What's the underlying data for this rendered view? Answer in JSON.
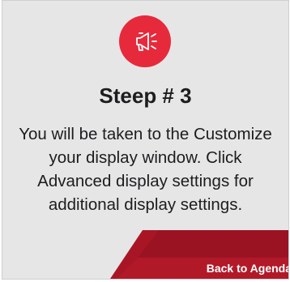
{
  "icon": {
    "name": "megaphone-icon",
    "bg_color": "#e72a3b"
  },
  "step_title": "Steep # 3",
  "instruction_lines": [
    "You will be taken to the Customize",
    "your display window. Click",
    "Advanced display settings for",
    "additional display settings."
  ],
  "navigation": {
    "back_label": "Back to Agenda"
  },
  "colors": {
    "card_bg": "#e6e6e7",
    "accent": "#e72a3b",
    "accent_dark": "#a81625"
  }
}
